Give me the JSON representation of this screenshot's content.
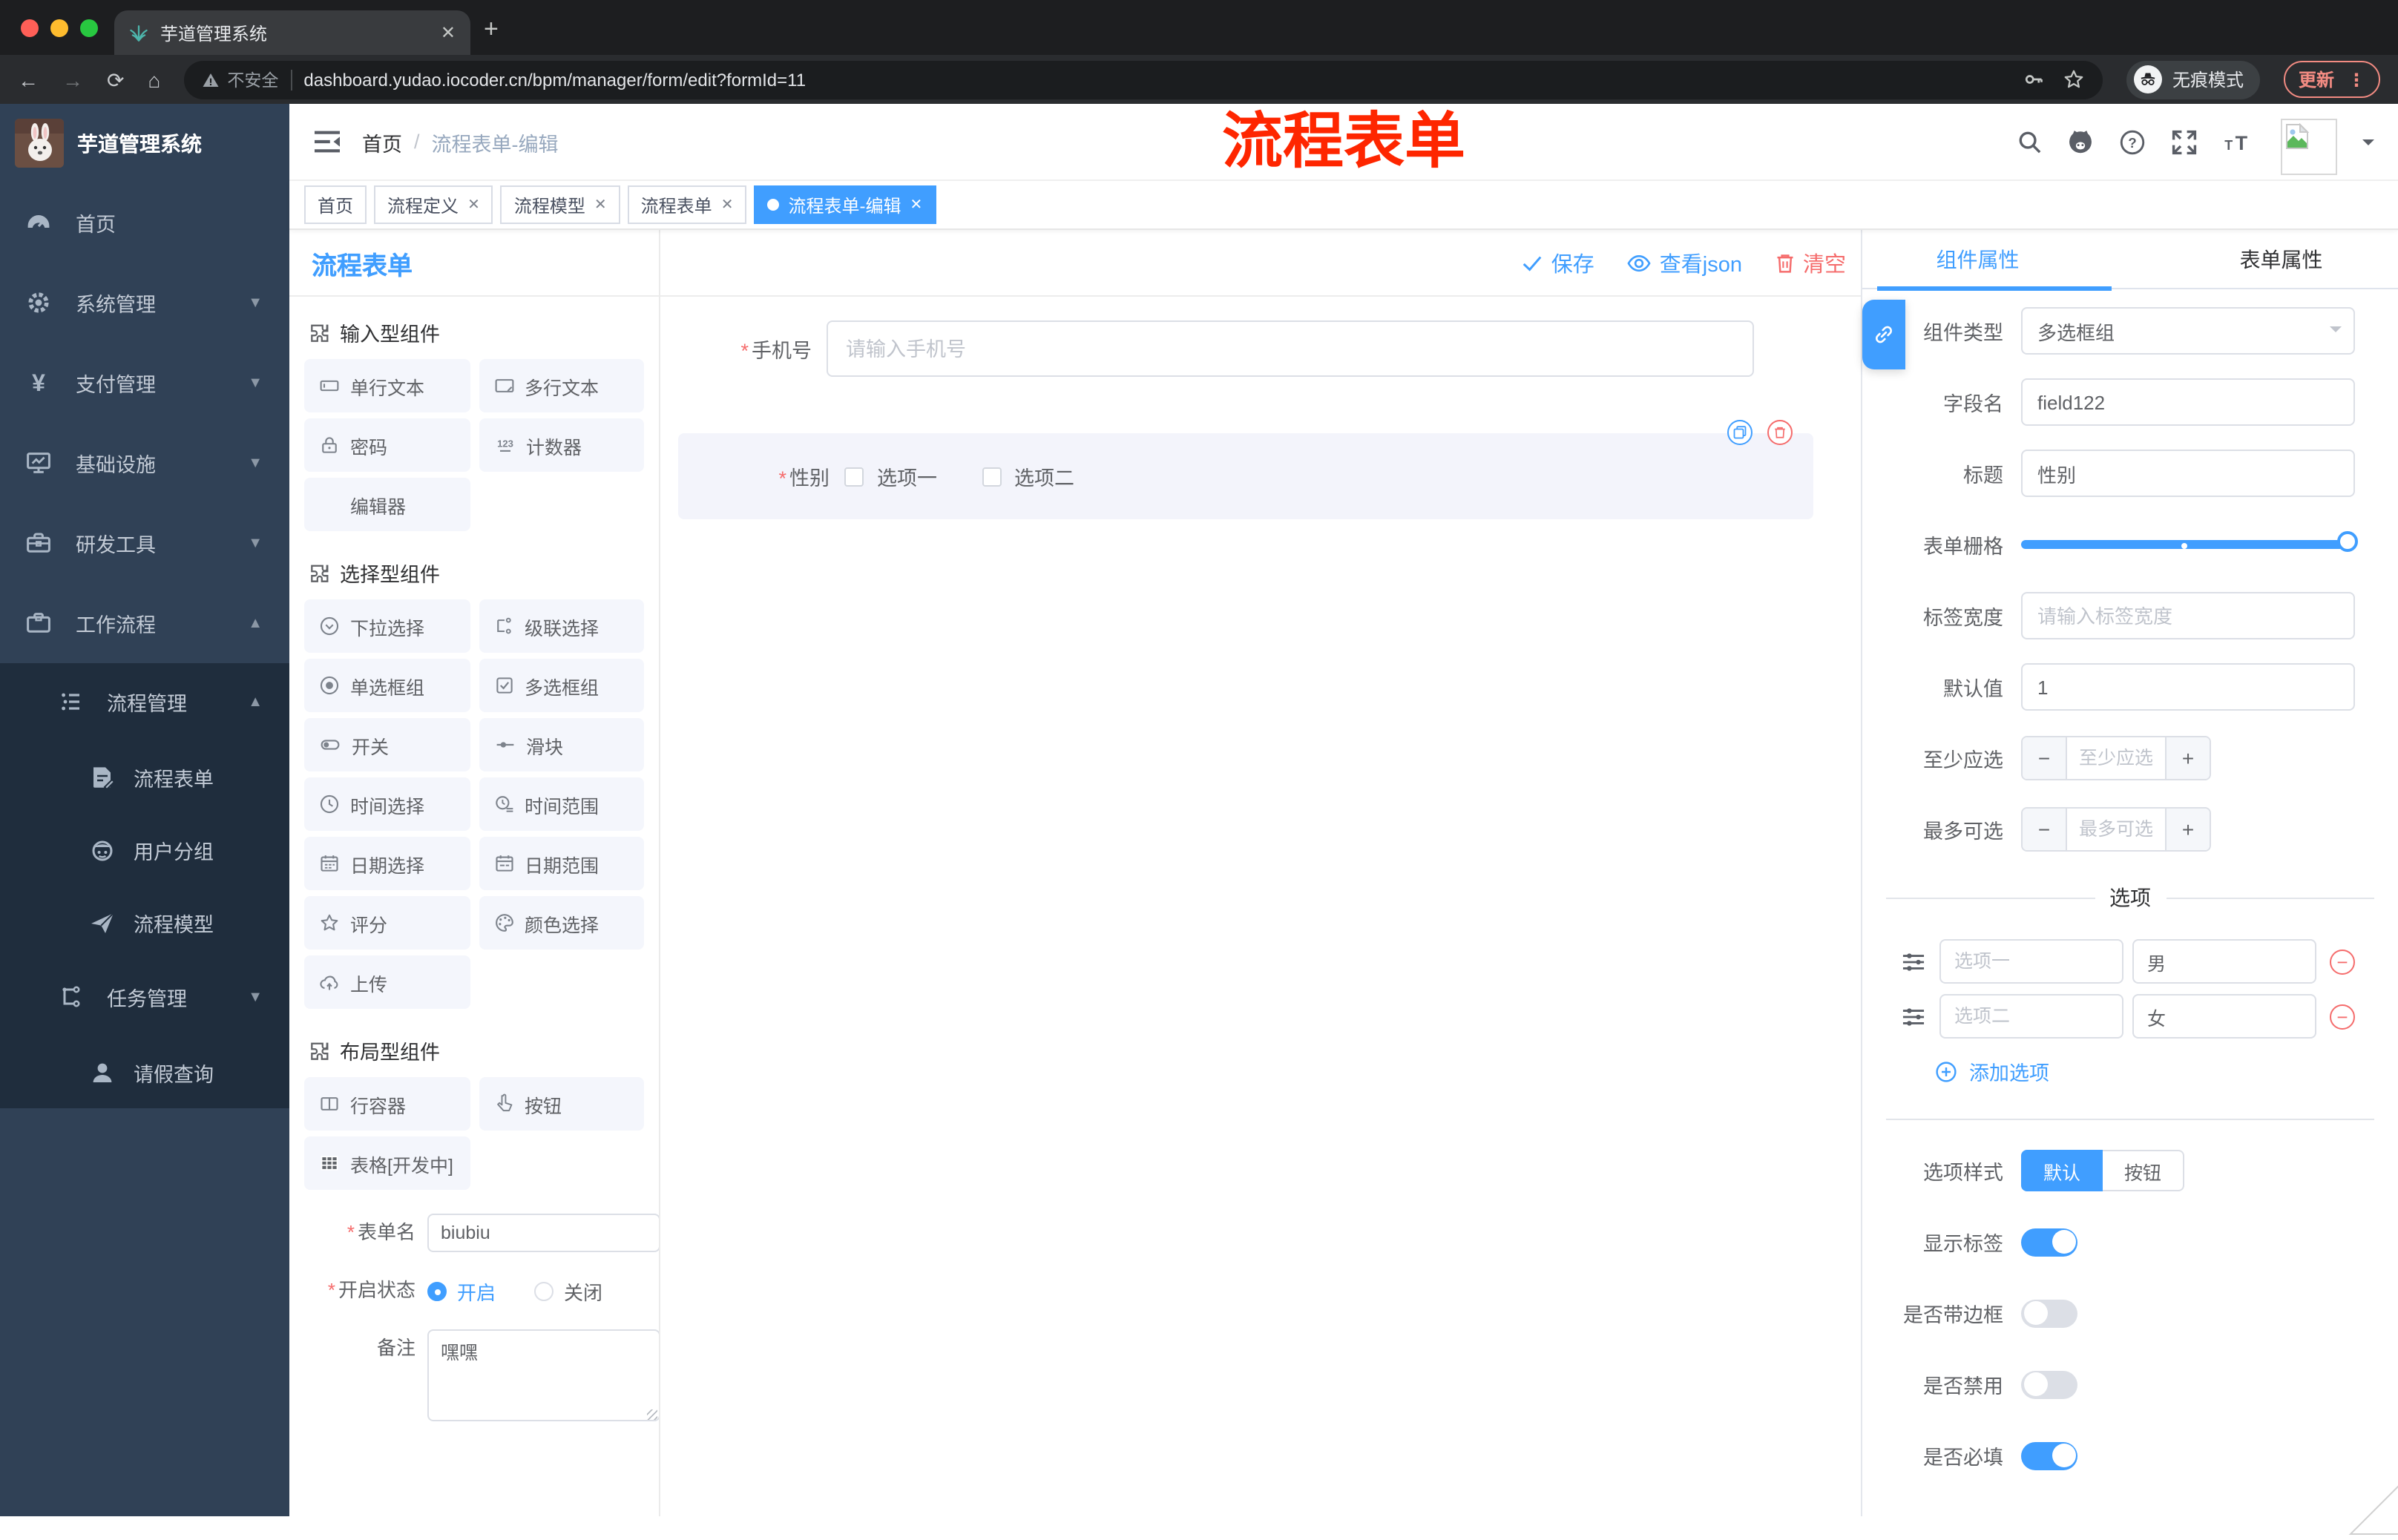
{
  "browser": {
    "tab_title": "芋道管理系统",
    "new_tab": "+",
    "security_label": "不安全",
    "url": "dashboard.yudao.iocoder.cn/bpm/manager/form/edit?formId=11",
    "incognito_label": "无痕模式",
    "update_label": "更新"
  },
  "sidebar": {
    "app_title": "芋道管理系统",
    "items": [
      "首页",
      "系统管理",
      "支付管理",
      "基础设施",
      "研发工具",
      "工作流程"
    ],
    "submenu": {
      "manage_label": "流程管理",
      "children": [
        "流程表单",
        "用户分组",
        "流程模型"
      ],
      "siblings": [
        "任务管理",
        "请假查询"
      ]
    }
  },
  "header": {
    "breadcrumb_home": "首页",
    "breadcrumb_sep": "/",
    "breadcrumb_current": "流程表单-编辑",
    "annotation": "流程表单"
  },
  "tags": [
    "首页",
    "流程定义",
    "流程模型",
    "流程表单",
    "流程表单-编辑"
  ],
  "designer": {
    "panel_title": "流程表单",
    "toolbar": {
      "save": "保存",
      "view_json": "查看json",
      "clear": "清空"
    },
    "sections": [
      {
        "title": "输入型组件",
        "items": [
          "单行文本",
          "多行文本",
          "密码",
          "计数器",
          "编辑器"
        ]
      },
      {
        "title": "选择型组件",
        "items": [
          "下拉选择",
          "级联选择",
          "单选框组",
          "多选框组",
          "开关",
          "滑块",
          "时间选择",
          "时间范围",
          "日期选择",
          "日期范围",
          "评分",
          "颜色选择",
          "上传"
        ]
      },
      {
        "title": "布局型组件",
        "items": [
          "行容器",
          "按钮",
          "表格[开发中]"
        ]
      }
    ],
    "form_meta": {
      "name_label": "表单名",
      "name_value": "biubiu",
      "status_label": "开启状态",
      "status_on": "开启",
      "status_off": "关闭",
      "remark_label": "备注",
      "remark_value": "嘿嘿"
    }
  },
  "canvas": {
    "phone": {
      "label": "手机号",
      "placeholder": "请输入手机号"
    },
    "gender": {
      "label": "性别",
      "options": [
        "选项一",
        "选项二"
      ]
    }
  },
  "properties": {
    "tab_component": "组件属性",
    "tab_form": "表单属性",
    "component_type": {
      "label": "组件类型",
      "value": "多选框组"
    },
    "field_name": {
      "label": "字段名",
      "value": "field122"
    },
    "title": {
      "label": "标题",
      "value": "性别"
    },
    "grid": {
      "label": "表单栅格"
    },
    "label_width": {
      "label": "标签宽度",
      "placeholder": "请输入标签宽度"
    },
    "default_value": {
      "label": "默认值",
      "value": "1"
    },
    "min_select": {
      "label": "至少应选",
      "placeholder": "至少应选",
      "minus": "−",
      "plus": "+"
    },
    "max_select": {
      "label": "最多可选",
      "placeholder": "最多可选",
      "minus": "−",
      "plus": "+"
    },
    "options_divider": "选项",
    "options": [
      {
        "label": "选项一",
        "value": "男"
      },
      {
        "label": "选项二",
        "value": "女"
      }
    ],
    "add_option": "添加选项",
    "option_style": {
      "label": "选项样式",
      "default": "默认",
      "button": "按钮"
    },
    "toggles": [
      {
        "label": "显示标签",
        "state": "on"
      },
      {
        "label": "是否带边框",
        "state": "off"
      },
      {
        "label": "是否禁用",
        "state": "off"
      },
      {
        "label": "是否必填",
        "state": "on"
      }
    ],
    "colors": {
      "primary": "#409eff",
      "danger": "#f56c6c"
    }
  }
}
